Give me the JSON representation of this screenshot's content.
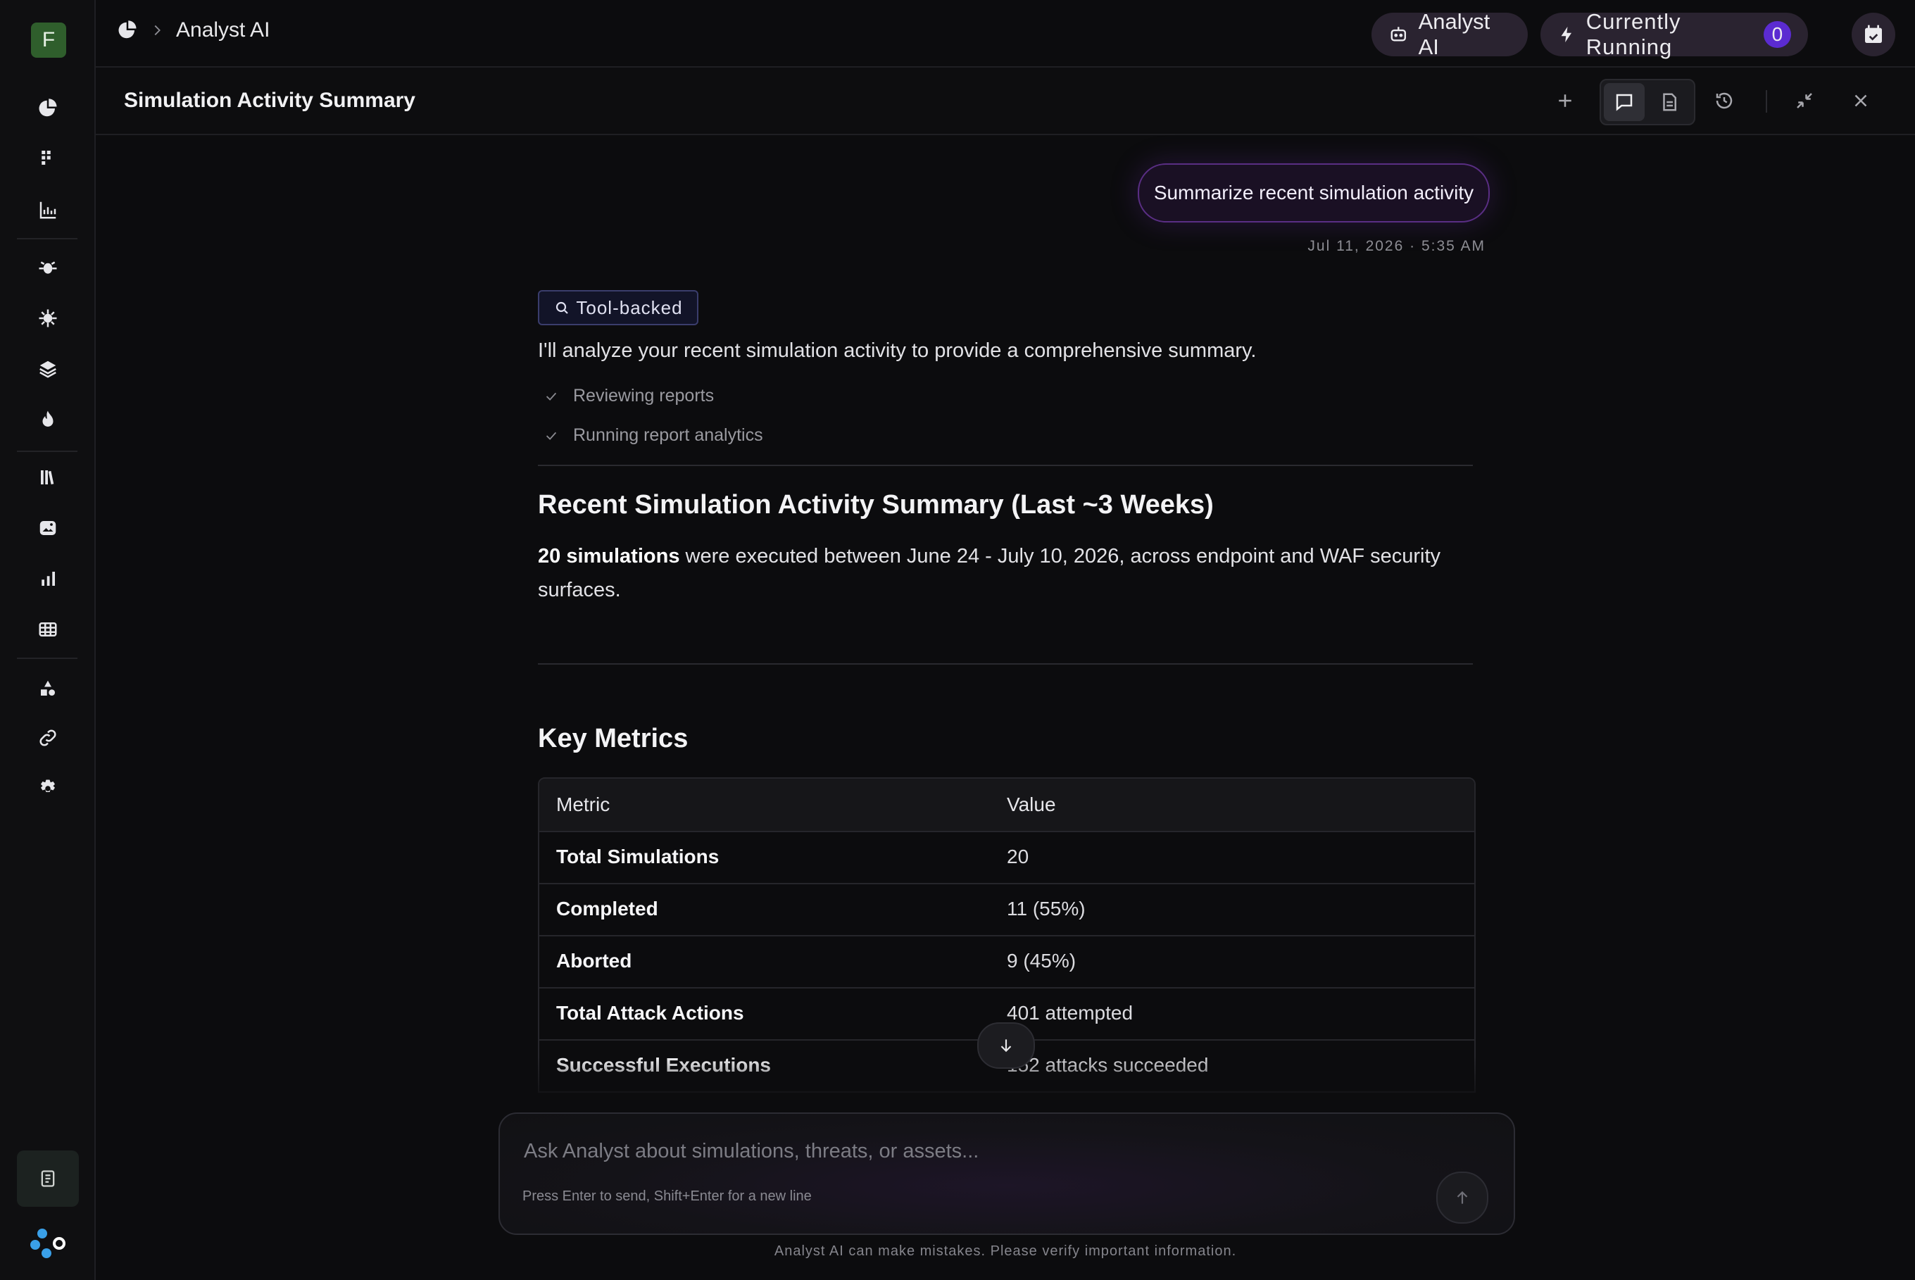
{
  "colors": {
    "background": "#0c0c0e",
    "accent_purple": "#5b2bd1",
    "avatar_green": "#2f5e2c",
    "user_bubble_border": "#5a2e84"
  },
  "user": {
    "avatar_initial": "F"
  },
  "sidebar": {
    "icons": [
      "pie-chart-icon",
      "grid-dots-icon",
      "bar-chart-icon",
      "bug-icon",
      "virus-icon",
      "layers-icon",
      "flame-icon",
      "library-icon",
      "image-icon",
      "signal-bars-icon",
      "table-icon",
      "shapes-icon",
      "link-icon",
      "gear-icon",
      "document-icon",
      "brand-logo-icon"
    ]
  },
  "header": {
    "breadcrumb": "Analyst AI",
    "analyst_button": "Analyst AI",
    "running_label": "Currently Running",
    "running_count": "0"
  },
  "panel": {
    "title": "Simulation Activity Summary"
  },
  "chat": {
    "user_message": "Summarize recent simulation activity",
    "user_timestamp": "Jul 11, 2026 · 5:35 AM",
    "badge": "Tool-backed",
    "intro": "I'll analyze your recent simulation activity to provide a comprehensive summary.",
    "steps": [
      "Reviewing reports",
      "Running report analytics"
    ],
    "summary_heading": "Recent Simulation Activity Summary (Last ~3 Weeks)",
    "summary_bold": "20 simulations",
    "summary_rest": " were executed between June 24 - July 10, 2026, across endpoint and WAF security surfaces.",
    "metrics_heading": "Key Metrics",
    "metrics_table": {
      "headers": [
        "Metric",
        "Value"
      ],
      "rows": [
        [
          "Total Simulations",
          "20"
        ],
        [
          "Completed",
          "11 (55%)"
        ],
        [
          "Aborted",
          "9 (45%)"
        ],
        [
          "Total Attack Actions",
          "401 attempted"
        ],
        [
          "Successful Executions",
          "152 attacks succeeded"
        ]
      ]
    }
  },
  "composer": {
    "placeholder": "Ask Analyst about simulations, threats, or assets...",
    "hint": "Press Enter to send, Shift+Enter for a new line",
    "disclaimer": "Analyst AI can make mistakes. Please verify important information."
  }
}
